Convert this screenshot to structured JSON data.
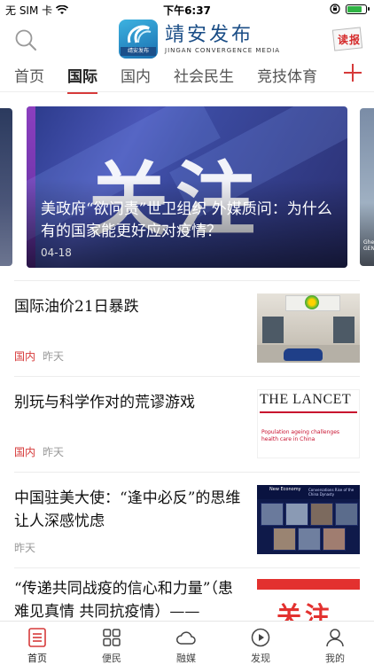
{
  "status": {
    "carrier": "无 SIM 卡",
    "time": "下午6:37",
    "battery_level": 0.85
  },
  "header": {
    "logo_cn": "靖安发布",
    "logo_en": "JINGAN CONVERGENCE MEDIA",
    "logo_badge": "靖安发布",
    "dubao_label": "读报"
  },
  "tabs": [
    {
      "label": "首页"
    },
    {
      "label": "国际",
      "active": true
    },
    {
      "label": "国内"
    },
    {
      "label": "社会民生"
    },
    {
      "label": "竞技体育"
    }
  ],
  "carousel": {
    "image_word": "关注",
    "title": "美政府“欲问责”世卫组织 外媒质问：为什么有的国家能更好应对疫情？",
    "date": "04-18",
    "right_card_tag": "Ghebr GEN"
  },
  "news": [
    {
      "title": "国际油价21日暴跌",
      "category": "国内",
      "time": "昨天",
      "thumb": "gas-station"
    },
    {
      "title": "别玩与科学作对的荒谬游戏",
      "category": "国内",
      "time": "昨天",
      "thumb": "lancet",
      "thumb_head": "THE LANCET",
      "thumb_sub": "Population ageing challenges health care in China"
    },
    {
      "title": "中国驻美大使：“逢中必反”的思维让人深感忧虑",
      "category": "",
      "time": "昨天",
      "thumb": "video-call",
      "thumb_bar_left": "New Economy",
      "thumb_bar_right": "Conversations Rise of the China Dynasty"
    },
    {
      "title": "“传递共同战疫的信心和力量”（患难见真情 共同抗疫情）——",
      "category": "",
      "time": "",
      "thumb": "red-banner",
      "thumb_word": "关注"
    }
  ],
  "tabbar": [
    {
      "label": "首页",
      "icon": "home-list-icon",
      "active": true
    },
    {
      "label": "便民",
      "icon": "grid-icon"
    },
    {
      "label": "融媒",
      "icon": "cloud-icon"
    },
    {
      "label": "发现",
      "icon": "play-circle-icon"
    },
    {
      "label": "我的",
      "icon": "person-icon"
    }
  ],
  "colors": {
    "accent": "#d63a3a",
    "brand": "#1a4d86"
  }
}
